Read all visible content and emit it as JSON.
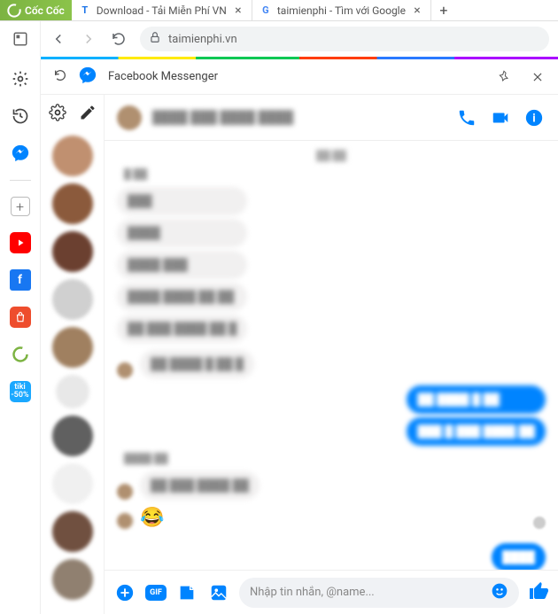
{
  "browser": {
    "logo_text": "Cốc Cốc",
    "tabs": [
      {
        "title": "Download - Tải Miễn Phí VN",
        "favicon_letter": "T"
      },
      {
        "title": "taimienphi - Tìm với Google",
        "favicon_letter": "G"
      }
    ],
    "url": "taimienphi.vn"
  },
  "left_rail": {
    "items": [
      "panel",
      "settings",
      "history",
      "messenger",
      "divider",
      "add",
      "youtube",
      "facebook",
      "shopee",
      "coccoc",
      "tiki"
    ]
  },
  "messenger": {
    "title": "Facebook Messenger",
    "chat": {
      "name": "████ ███ ████ ████",
      "timestamp": "██:██",
      "messages_left_1": [
        "███",
        "████",
        "████ ███",
        "████ ████ ██ ██",
        "██ ███ ████ ██ █"
      ],
      "messages_left_2": [
        "██ ████ █ ██ █"
      ],
      "messages_right_1": [
        "██ ████ █ ██",
        "███ █ ███ ████ ██"
      ],
      "sender_a": "█ ██",
      "sender_b": "████ ██",
      "messages_left_3": [
        "██ ███ ████ ██"
      ],
      "bottom_bubble": "████"
    },
    "input_placeholder": "Nhập tin nhắn, @name..."
  }
}
